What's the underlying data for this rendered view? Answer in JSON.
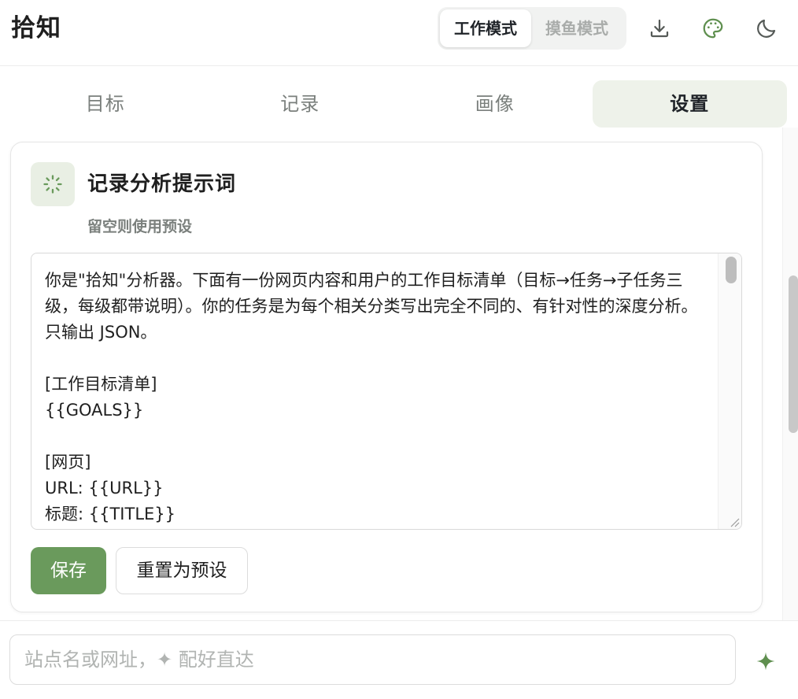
{
  "app": {
    "title": "拾知"
  },
  "header": {
    "modes": [
      {
        "label": "工作模式",
        "active": true
      },
      {
        "label": "摸鱼模式",
        "active": false
      }
    ],
    "icons": [
      "download-icon",
      "palette-icon",
      "moon-icon"
    ]
  },
  "tabs": [
    {
      "label": "目标",
      "active": false
    },
    {
      "label": "记录",
      "active": false
    },
    {
      "label": "画像",
      "active": false
    },
    {
      "label": "设置",
      "active": true
    }
  ],
  "card": {
    "icon": "spinner-icon",
    "title": "记录分析提示词",
    "subtitle": "留空则使用预设",
    "prompt_value": "你是\"拾知\"分析器。下面有一份网页内容和用户的工作目标清单（目标→任务→子任务三级，每级都带说明）。你的任务是为每个相关分类写出完全不同的、有针对性的深度分析。只输出 JSON。\n\n[工作目标清单]\n{{GOALS}}\n\n[网页]\nURL: {{URL}}\n标题: {{TITLE}}",
    "save_label": "保存",
    "reset_label": "重置为预设"
  },
  "bottom": {
    "placeholder": "站点名或网址，✦ 配好直达",
    "sparkle_icon": "sparkle-icon"
  },
  "colors": {
    "accent": "#6a9a5c",
    "accent_light": "#eef2ea",
    "icon_green": "#5f8f4f"
  }
}
